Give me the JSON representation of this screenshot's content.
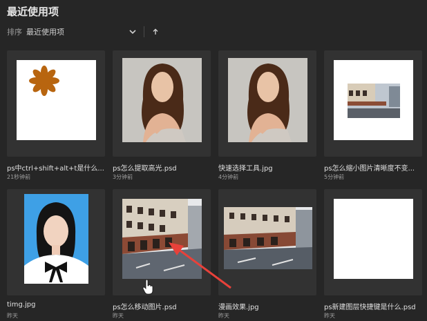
{
  "title": "最近使用项",
  "sort": {
    "label": "排序",
    "value": "最近使用项",
    "options_icon": "chevron-down-icon",
    "direction_icon": "sort-ascending-icon"
  },
  "files": [
    {
      "name": "ps中ctrl+shift+alt+t是什么...",
      "time": "21秒钟前"
    },
    {
      "name": "ps怎么提取高光.psd",
      "time": "3分钟前"
    },
    {
      "name": "快速选择工具.jpg",
      "time": "4分钟前"
    },
    {
      "name": "ps怎么缩小图片清晰度不变...",
      "time": "5分钟前"
    },
    {
      "name": "timg.jpg",
      "time": "昨天"
    },
    {
      "name": "ps怎么移动图片.psd",
      "time": "昨天"
    },
    {
      "name": "漫画效果.jpg",
      "time": "昨天"
    },
    {
      "name": "ps新建图层快捷键是什么.psd",
      "time": "昨天"
    }
  ],
  "colors": {
    "background": "#262626",
    "tile": "#323232",
    "annotation_arrow": "#e8413a"
  }
}
